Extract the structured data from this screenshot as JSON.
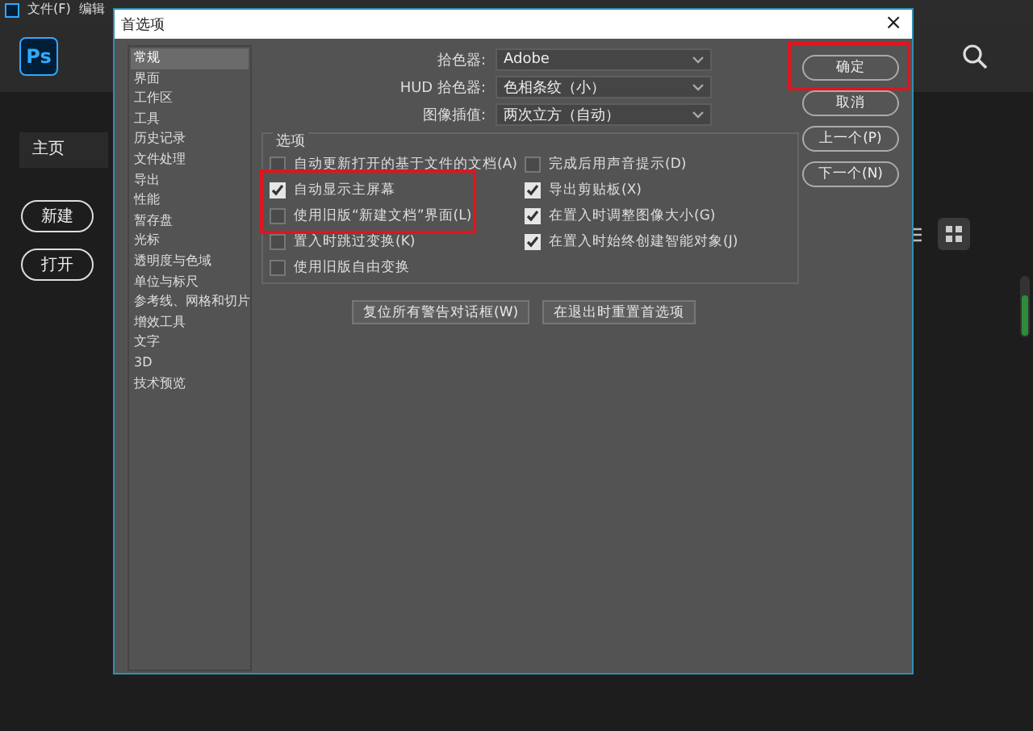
{
  "app": {
    "menu": [
      "文件(F)",
      "编辑"
    ],
    "logo": "Ps",
    "home_tab": "主页",
    "buttons": [
      "新建",
      "打开"
    ]
  },
  "dialog": {
    "title": "首选项",
    "close": "×",
    "categories": [
      {
        "label": "常规",
        "selected": true
      },
      {
        "label": "界面",
        "selected": false
      },
      {
        "label": "工作区",
        "selected": false
      },
      {
        "label": "工具",
        "selected": false
      },
      {
        "label": "历史记录",
        "selected": false
      },
      {
        "label": "文件处理",
        "selected": false
      },
      {
        "label": "导出",
        "selected": false
      },
      {
        "label": "性能",
        "selected": false
      },
      {
        "label": "暂存盘",
        "selected": false
      },
      {
        "label": "光标",
        "selected": false
      },
      {
        "label": "透明度与色域",
        "selected": false
      },
      {
        "label": "单位与标尺",
        "selected": false
      },
      {
        "label": "参考线、网格和切片",
        "selected": false
      },
      {
        "label": "增效工具",
        "selected": false
      },
      {
        "label": "文字",
        "selected": false
      },
      {
        "label": "3D",
        "selected": false
      },
      {
        "label": "技术预览",
        "selected": false
      }
    ],
    "fields": [
      {
        "label": "拾色器:",
        "value": "Adobe"
      },
      {
        "label": "HUD 拾色器:",
        "value": "色相条纹（小）"
      },
      {
        "label": "图像插值:",
        "value": "两次立方（自动）"
      }
    ],
    "options_title": "选项",
    "options_left": [
      {
        "label": "自动更新打开的基于文件的文档(A)",
        "checked": false
      },
      {
        "label": "自动显示主屏幕",
        "checked": true
      },
      {
        "label": "使用旧版“新建文档”界面(L)",
        "checked": false
      },
      {
        "label": "置入时跳过变换(K)",
        "checked": false
      },
      {
        "label": "使用旧版自由变换",
        "checked": false
      }
    ],
    "options_right": [
      {
        "label": "完成后用声音提示(D)",
        "checked": false
      },
      {
        "label": "导出剪贴板(X)",
        "checked": true
      },
      {
        "label": "在置入时调整图像大小(G)",
        "checked": true
      },
      {
        "label": "在置入时始终创建智能对象(J)",
        "checked": true
      }
    ],
    "reset_buttons": [
      "复位所有警告对话框(W)",
      "在退出时重置首选项"
    ],
    "side_buttons": [
      "确定",
      "取消",
      "上一个(P)",
      "下一个(N)"
    ]
  }
}
